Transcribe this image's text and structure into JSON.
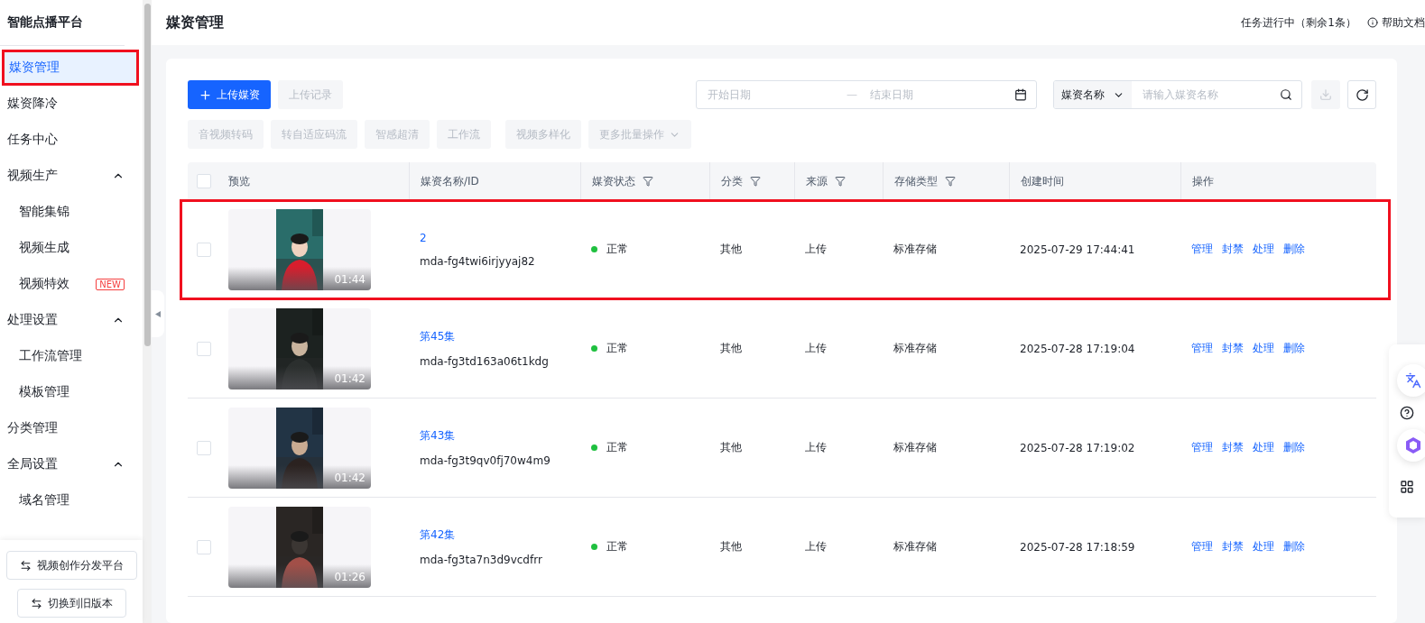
{
  "sidebar": {
    "title": "智能点播平台",
    "items": [
      {
        "label": "媒资管理",
        "selected": true,
        "annotated": true
      },
      {
        "label": "媒资降冷",
        "selected": false,
        "annotated": false
      },
      {
        "label": "任务中心",
        "selected": false,
        "annotated": false
      },
      {
        "label": "视频生产",
        "selected": false,
        "annotated": false,
        "expanded": true,
        "children": [
          {
            "label": "智能集锦",
            "selected": false
          },
          {
            "label": "视频生成",
            "selected": false
          },
          {
            "label": "视频特效",
            "selected": false,
            "badge": "NEW"
          }
        ]
      },
      {
        "label": "处理设置",
        "selected": false,
        "annotated": false,
        "expanded": true,
        "children": [
          {
            "label": "工作流管理",
            "selected": false
          },
          {
            "label": "模板管理",
            "selected": false
          }
        ]
      },
      {
        "label": "分类管理",
        "selected": false,
        "annotated": false
      },
      {
        "label": "全局设置",
        "selected": false,
        "annotated": false,
        "expanded": true,
        "children": [
          {
            "label": "域名管理",
            "selected": false
          }
        ]
      }
    ],
    "bottom_buttons": [
      "视频创作分发平台",
      "切换到旧版本"
    ]
  },
  "header": {
    "title": "媒资管理",
    "task_status": "任务进行中（剩余1条）",
    "help": "帮助文档"
  },
  "toolbar": {
    "primary": "上传媒资",
    "secondary": "上传记录",
    "start_placeholder": "开始日期",
    "end_placeholder": "结束日期",
    "range_sep": "—",
    "search_type": "媒资名称",
    "search_placeholder": "请输入媒资名称",
    "batch_buttons": [
      {
        "label": "音视频转码",
        "dropdown": false
      },
      {
        "label": "转自适应码流",
        "dropdown": false
      },
      {
        "label": "智感超清",
        "dropdown": false
      },
      {
        "label": "工作流",
        "dropdown": false
      },
      {
        "label": "视频多样化",
        "dropdown": false
      },
      {
        "label": "更多批量操作",
        "dropdown": true
      }
    ]
  },
  "table": {
    "select_all_checked": false,
    "columns": [
      {
        "label": "预览",
        "filter": false
      },
      {
        "label": "媒资名称/ID",
        "filter": false
      },
      {
        "label": "媒资状态",
        "filter": true
      },
      {
        "label": "分类",
        "filter": true
      },
      {
        "label": "来源",
        "filter": true
      },
      {
        "label": "存储类型",
        "filter": true
      },
      {
        "label": "创建时间",
        "filter": false
      },
      {
        "label": "操作",
        "filter": false
      }
    ],
    "rows": [
      {
        "checked": false,
        "annotated": true,
        "duration": "01:44",
        "name": "2",
        "id": "mda-fg4twi6irjyyaj82",
        "status": "正常",
        "color": "#1fc03f",
        "category": "其他",
        "source": "上传",
        "storage": "标准存储",
        "created": "2025-07-29 17:44:41",
        "actions": [
          "管理",
          "封禁",
          "处理",
          "删除"
        ]
      },
      {
        "checked": false,
        "annotated": false,
        "duration": "01:42",
        "name": "第45集",
        "id": "mda-fg3td163a06t1kdg",
        "status": "正常",
        "color": "#1fc03f",
        "category": "其他",
        "source": "上传",
        "storage": "标准存储",
        "created": "2025-07-28 17:19:04",
        "actions": [
          "管理",
          "封禁",
          "处理",
          "删除"
        ]
      },
      {
        "checked": false,
        "annotated": false,
        "duration": "01:42",
        "name": "第43集",
        "id": "mda-fg3t9qv0fj70w4m9",
        "status": "正常",
        "color": "#1fc03f",
        "category": "其他",
        "source": "上传",
        "storage": "标准存储",
        "created": "2025-07-28 17:19:02",
        "actions": [
          "管理",
          "封禁",
          "处理",
          "删除"
        ]
      },
      {
        "checked": false,
        "annotated": false,
        "duration": "01:26",
        "name": "第42集",
        "id": "mda-fg3ta7n3d9vcdfrr",
        "status": "正常",
        "color": "#1fc03f",
        "category": "其他",
        "source": "上传",
        "storage": "标准存储",
        "created": "2025-07-28 17:18:59",
        "actions": [
          "管理",
          "封禁",
          "处理",
          "删除"
        ]
      }
    ]
  }
}
